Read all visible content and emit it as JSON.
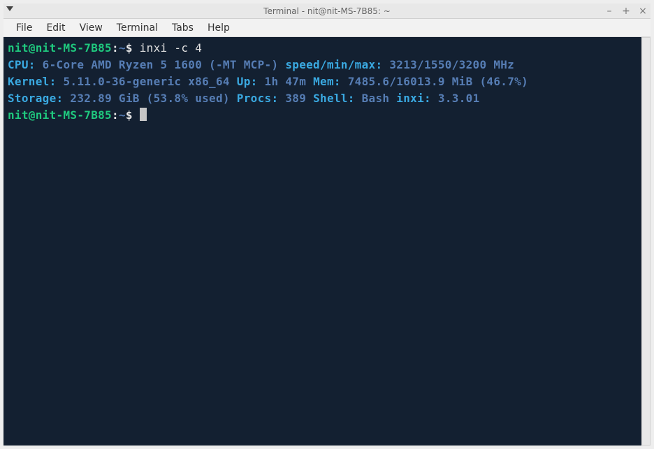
{
  "window": {
    "title": "Terminal - nit@nit-MS-7B85: ~"
  },
  "menubar": {
    "items": [
      "File",
      "Edit",
      "View",
      "Terminal",
      "Tabs",
      "Help"
    ]
  },
  "prompt": {
    "user_host": "nit@nit-MS-7B85",
    "separator": ":",
    "path": "~",
    "symbol": "$"
  },
  "command1": "inxi -c 4",
  "output": {
    "cpu_label": "CPU:",
    "cpu_value": " 6-Core AMD Ryzen 5 1600 (-MT MCP-) ",
    "speed_label": "speed/min/max:",
    "speed_value": " 3213/1550/3200 MHz ",
    "kernel_label": "Kernel:",
    "kernel_value": " 5.11.0-36-generic x86_64 ",
    "up_label": "Up:",
    "up_value": " 1h 47m ",
    "mem_label": "Mem:",
    "mem_value": " 7485.6/16013.9 MiB (46.7%) ",
    "storage_label": "Storage:",
    "storage_value": " 232.89 GiB (53.8% used) ",
    "procs_label": "Procs:",
    "procs_value": " 389 ",
    "shell_label": "Shell:",
    "shell_value": " Bash ",
    "inxi_label": "inxi:",
    "inxi_value": " 3.3.01 "
  }
}
